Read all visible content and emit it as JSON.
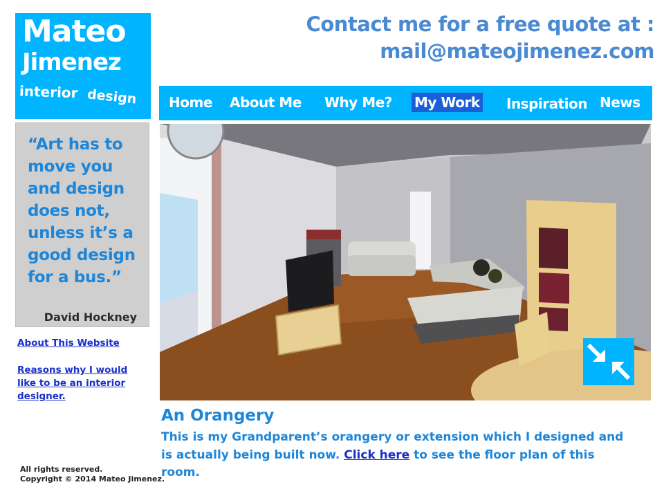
{
  "logo": {
    "line1": "Mateo",
    "line2": "Jimenez",
    "line3": "interior",
    "line4": "design"
  },
  "header": {
    "contact_line1": "Contact me for a free quote at :",
    "contact_line2": "mail@mateojimenez.com"
  },
  "nav": {
    "items": [
      "Home",
      "About Me",
      "Why Me?",
      "My Work",
      "Inspiration",
      "News"
    ],
    "active": "My Work"
  },
  "quote": {
    "text": "“Art has to move you and design does not, unless it’s a good design for a bus.”",
    "author": "David Hockney"
  },
  "sidebar": {
    "links": [
      "About This Website",
      "Reasons why I would like to be an interior designer."
    ]
  },
  "footer": {
    "line1": "All rights reserved.",
    "line2": "Copyright © 2014 Mateo Jimenez."
  },
  "content": {
    "title": "An Orangery",
    "body_before": "This is my Grandparent’s orangery or extension which I designed and is actually being built now.",
    "link_text": "Click here",
    "body_after": "to see the floor plan of this room."
  },
  "colors": {
    "accent": "#00b4ff",
    "active_nav": "#1a5fd8",
    "heading_text": "#4a8ad2",
    "body_text": "#1e86d8",
    "link": "#1a30c8"
  },
  "icons": {
    "expand": "collapse-arrows-icon"
  }
}
